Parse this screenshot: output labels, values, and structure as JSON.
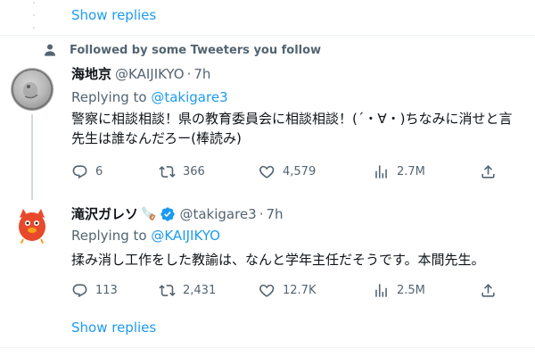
{
  "show_replies_label": "Show replies",
  "social_context": "Followed by some Tweeters you follow",
  "tweets": [
    {
      "display_name": "海地京",
      "handle": "@KAIJIKYO",
      "time": "7h",
      "replying_prefix": "Replying to",
      "replying_to": "@takigare3",
      "text_line1": "警察に相談相談！県の教育委員会に相談相談！(´・∀・)ちなみに消せと言",
      "text_line2": "先生は誰なんだろー(棒読み)",
      "replies": "6",
      "retweets": "366",
      "likes": "4,579",
      "views": "2.7M"
    },
    {
      "display_name": "滝沢ガレソ",
      "name_emoji": "🪚",
      "handle": "@takigare3",
      "time": "7h",
      "replying_prefix": "Replying to",
      "replying_to": "@KAIJIKYO",
      "text_line1": "揉み消し工作をした教諭は、なんと学年主任だそうです。本間先生。",
      "replies": "113",
      "retweets": "2,431",
      "likes": "12.7K",
      "views": "2.5M"
    }
  ],
  "colors": {
    "link": "#1d9bf0",
    "secondary": "#536471",
    "verified": "#1d9bf0",
    "mascot": "#e8492b"
  },
  "icons": [
    "person-icon",
    "reply-icon",
    "retweet-icon",
    "like-icon",
    "views-icon",
    "share-icon",
    "verified-badge-icon"
  ]
}
